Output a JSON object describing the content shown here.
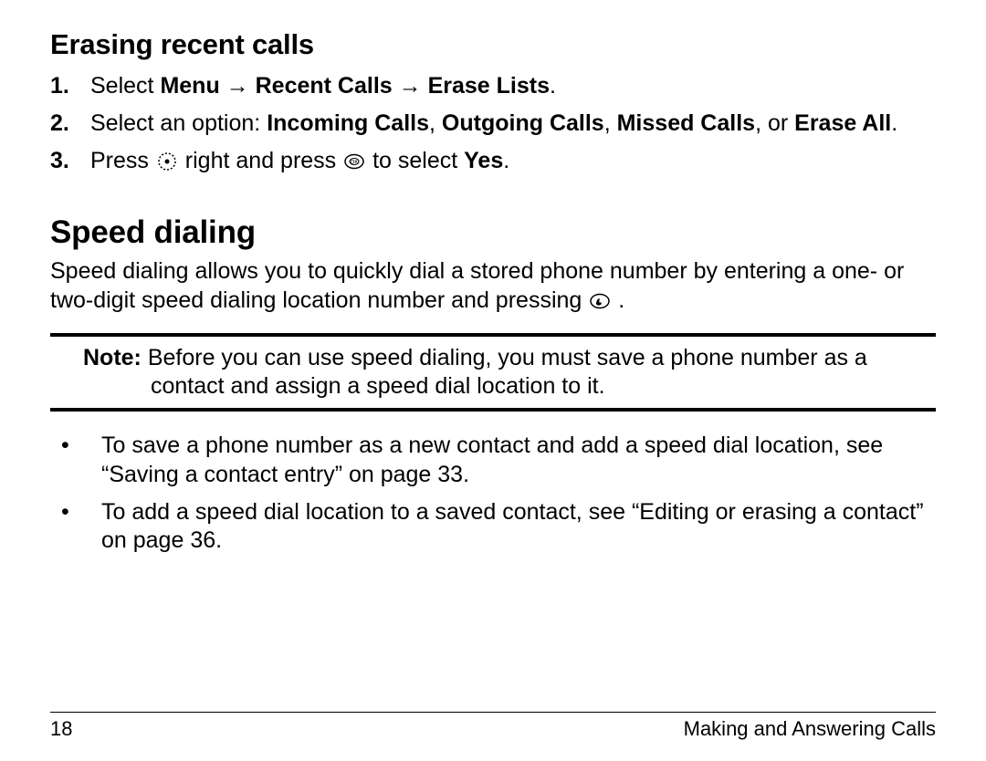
{
  "heading1": "Erasing recent calls",
  "steps": [
    {
      "num": "1.",
      "pre": "Select ",
      "path1": "Menu",
      "arrow": " → ",
      "path2": "Recent Calls",
      "path3": "Erase Lists",
      "post": "."
    },
    {
      "num": "2.",
      "pre": "Select an option: ",
      "opt1": "Incoming Calls",
      "sep1": ", ",
      "opt2": "Outgoing Calls",
      "sep2": ", ",
      "opt3": "Missed Calls",
      "sep3": ", or ",
      "opt4": "Erase All",
      "post": "."
    },
    {
      "num": "3.",
      "pre": "Press ",
      "mid1": " right and press ",
      "mid2": " to select ",
      "yes": "Yes",
      "post": "."
    }
  ],
  "heading2": "Speed dialing",
  "intro_a": "Speed dialing allows you to quickly dial a stored phone number by entering a one- or two-digit speed dialing location number and pressing ",
  "intro_b": " .",
  "note_label": "Note: ",
  "note_text": "Before you can use speed dialing, you must save a phone number as a contact and assign a speed dial location to it.",
  "bullets": [
    "To save a phone number as a new contact and add a speed dial location, see “Saving a contact entry” on page 33.",
    "To add a speed dial location to a saved contact, see “Editing or erasing a contact” on page 36."
  ],
  "footer": {
    "page": "18",
    "section": "Making and Answering Calls"
  }
}
